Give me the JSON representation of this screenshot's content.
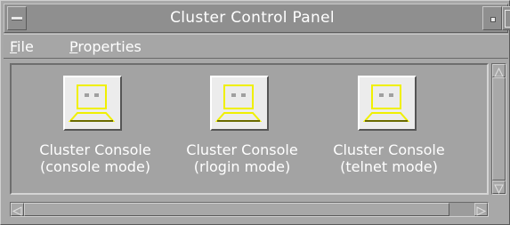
{
  "window": {
    "title": "Cluster Control Panel"
  },
  "menubar": {
    "file": {
      "mnemonic": "F",
      "rest": "ile"
    },
    "properties": {
      "mnemonic": "P",
      "rest": "roperties"
    }
  },
  "icons": [
    {
      "line1": "Cluster Console",
      "line2": "(console mode)",
      "icon": "terminal-icon"
    },
    {
      "line1": "Cluster Console",
      "line2": "(rlogin mode)",
      "icon": "terminal-icon"
    },
    {
      "line1": "Cluster Console",
      "line2": "(telnet mode)",
      "icon": "terminal-icon"
    }
  ],
  "colors": {
    "titlebar": "#8f8f8f",
    "background": "#a8a8a8",
    "icon_accent": "#f0f000",
    "text": "#ffffff"
  }
}
